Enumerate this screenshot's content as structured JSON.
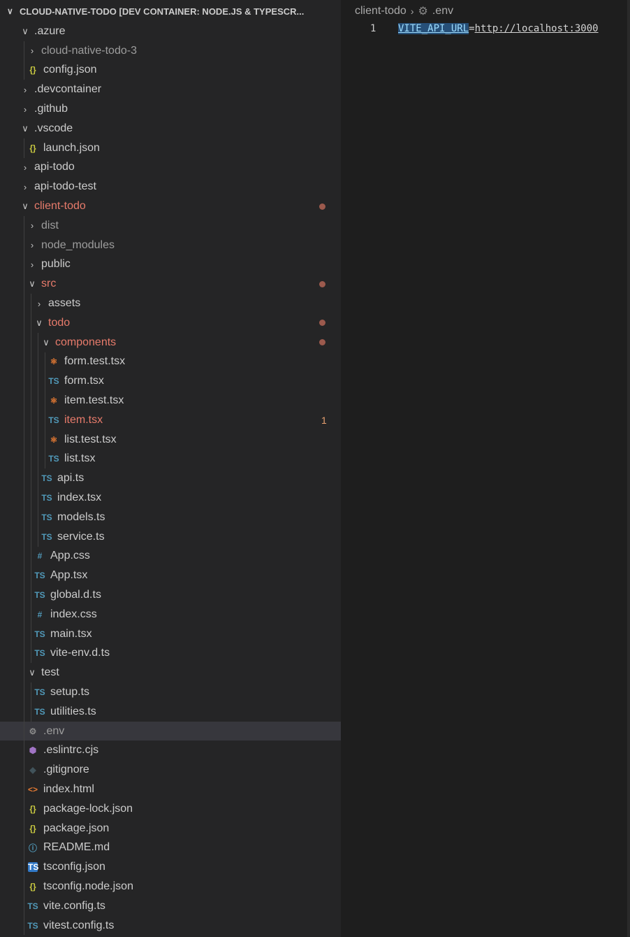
{
  "explorer": {
    "title": "CLOUD-NATIVE-TODO [DEV CONTAINER: NODE.JS & TYPESCR...",
    "items": [
      {
        "label": ".azure",
        "depth": 0,
        "type": "folder",
        "open": true
      },
      {
        "label": "cloud-native-todo-3",
        "depth": 1,
        "type": "folder",
        "open": false,
        "dim": true
      },
      {
        "label": "config.json",
        "depth": 1,
        "type": "file",
        "icon": "json"
      },
      {
        "label": ".devcontainer",
        "depth": 0,
        "type": "folder",
        "open": false
      },
      {
        "label": ".github",
        "depth": 0,
        "type": "folder",
        "open": false
      },
      {
        "label": ".vscode",
        "depth": 0,
        "type": "folder",
        "open": true
      },
      {
        "label": "launch.json",
        "depth": 1,
        "type": "file",
        "icon": "json"
      },
      {
        "label": "api-todo",
        "depth": 0,
        "type": "folder",
        "open": false
      },
      {
        "label": "api-todo-test",
        "depth": 0,
        "type": "folder",
        "open": false
      },
      {
        "label": "client-todo",
        "depth": 0,
        "type": "folder",
        "open": true,
        "git": true,
        "dot": true
      },
      {
        "label": "dist",
        "depth": 1,
        "type": "folder",
        "open": false,
        "dim": true
      },
      {
        "label": "node_modules",
        "depth": 1,
        "type": "folder",
        "open": false,
        "dim": true
      },
      {
        "label": "public",
        "depth": 1,
        "type": "folder",
        "open": false
      },
      {
        "label": "src",
        "depth": 1,
        "type": "folder",
        "open": true,
        "git": true,
        "dot": true
      },
      {
        "label": "assets",
        "depth": 2,
        "type": "folder",
        "open": false
      },
      {
        "label": "todo",
        "depth": 2,
        "type": "folder",
        "open": true,
        "git": true,
        "dot": true
      },
      {
        "label": "components",
        "depth": 3,
        "type": "folder",
        "open": true,
        "git": true,
        "dot": true
      },
      {
        "label": "form.test.tsx",
        "depth": 4,
        "type": "file",
        "icon": "react"
      },
      {
        "label": "form.tsx",
        "depth": 4,
        "type": "file",
        "icon": "ts"
      },
      {
        "label": "item.test.tsx",
        "depth": 4,
        "type": "file",
        "icon": "react"
      },
      {
        "label": "item.tsx",
        "depth": 4,
        "type": "file",
        "icon": "ts",
        "git": true,
        "count": "1"
      },
      {
        "label": "list.test.tsx",
        "depth": 4,
        "type": "file",
        "icon": "react"
      },
      {
        "label": "list.tsx",
        "depth": 4,
        "type": "file",
        "icon": "ts"
      },
      {
        "label": "api.ts",
        "depth": 3,
        "type": "file",
        "icon": "ts"
      },
      {
        "label": "index.tsx",
        "depth": 3,
        "type": "file",
        "icon": "ts"
      },
      {
        "label": "models.ts",
        "depth": 3,
        "type": "file",
        "icon": "ts"
      },
      {
        "label": "service.ts",
        "depth": 3,
        "type": "file",
        "icon": "ts"
      },
      {
        "label": "App.css",
        "depth": 2,
        "type": "file",
        "icon": "hash"
      },
      {
        "label": "App.tsx",
        "depth": 2,
        "type": "file",
        "icon": "ts"
      },
      {
        "label": "global.d.ts",
        "depth": 2,
        "type": "file",
        "icon": "ts"
      },
      {
        "label": "index.css",
        "depth": 2,
        "type": "file",
        "icon": "hash"
      },
      {
        "label": "main.tsx",
        "depth": 2,
        "type": "file",
        "icon": "ts"
      },
      {
        "label": "vite-env.d.ts",
        "depth": 2,
        "type": "file",
        "icon": "ts"
      },
      {
        "label": "test",
        "depth": 1,
        "type": "folder",
        "open": true
      },
      {
        "label": "setup.ts",
        "depth": 2,
        "type": "file",
        "icon": "ts"
      },
      {
        "label": "utilities.ts",
        "depth": 2,
        "type": "file",
        "icon": "ts"
      },
      {
        "label": ".env",
        "depth": 1,
        "type": "file",
        "icon": "gear",
        "selected": true,
        "dim": true
      },
      {
        "label": ".eslintrc.cjs",
        "depth": 1,
        "type": "file",
        "icon": "eslint"
      },
      {
        "label": ".gitignore",
        "depth": 1,
        "type": "file",
        "icon": "git"
      },
      {
        "label": "index.html",
        "depth": 1,
        "type": "file",
        "icon": "html"
      },
      {
        "label": "package-lock.json",
        "depth": 1,
        "type": "file",
        "icon": "json"
      },
      {
        "label": "package.json",
        "depth": 1,
        "type": "file",
        "icon": "json"
      },
      {
        "label": "README.md",
        "depth": 1,
        "type": "file",
        "icon": "info"
      },
      {
        "label": "tsconfig.json",
        "depth": 1,
        "type": "file",
        "icon": "tsconfig"
      },
      {
        "label": "tsconfig.node.json",
        "depth": 1,
        "type": "file",
        "icon": "json"
      },
      {
        "label": "vite.config.ts",
        "depth": 1,
        "type": "file",
        "icon": "ts"
      },
      {
        "label": "vitest.config.ts",
        "depth": 1,
        "type": "file",
        "icon": "ts"
      }
    ]
  },
  "editor": {
    "breadcrumb": {
      "folder": "client-todo",
      "file": ".env"
    },
    "line_number": "1",
    "code_key": "VITE_API_URL",
    "code_eq": "=",
    "code_value": "http://localhost:3000"
  },
  "colors": {
    "git_modified": "#e77b6b",
    "ts_icon": "#519aba",
    "json_icon": "#cbcb41",
    "react_icon": "#e37933"
  }
}
